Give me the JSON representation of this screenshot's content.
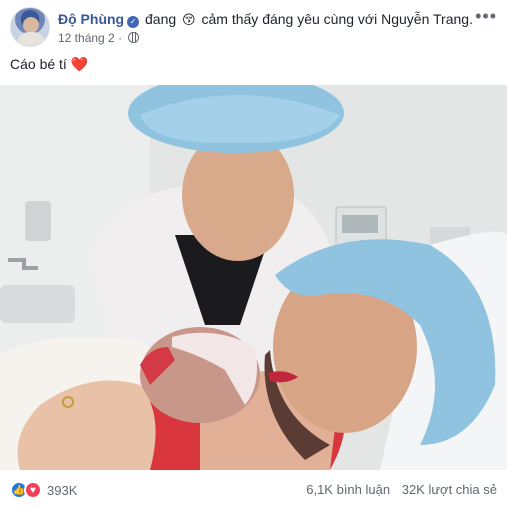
{
  "post": {
    "author": "Độ Phùng",
    "activity_prefix": "đang",
    "feeling_emoji": "😚",
    "activity_text": "cảm thấy đáng yêu cùng với",
    "tagged": "Nguyễn Trang.",
    "date": "12 tháng 2",
    "separator": "·",
    "more": "•••",
    "caption": "Cáo bé tí",
    "caption_heart": "❤️"
  },
  "footer": {
    "reaction_count": "393K",
    "comments": "6,1K bình luận",
    "shares": "32K lượt chia sẻ"
  },
  "colors": {
    "author": "#385898",
    "verified": "#4267b2",
    "like": "#1877f2",
    "love": "#f33e58"
  },
  "icons": {
    "verified": "verified-badge-icon",
    "privacy": "globe-icon",
    "like": "like-icon",
    "love": "love-icon",
    "more": "more-options-icon"
  }
}
